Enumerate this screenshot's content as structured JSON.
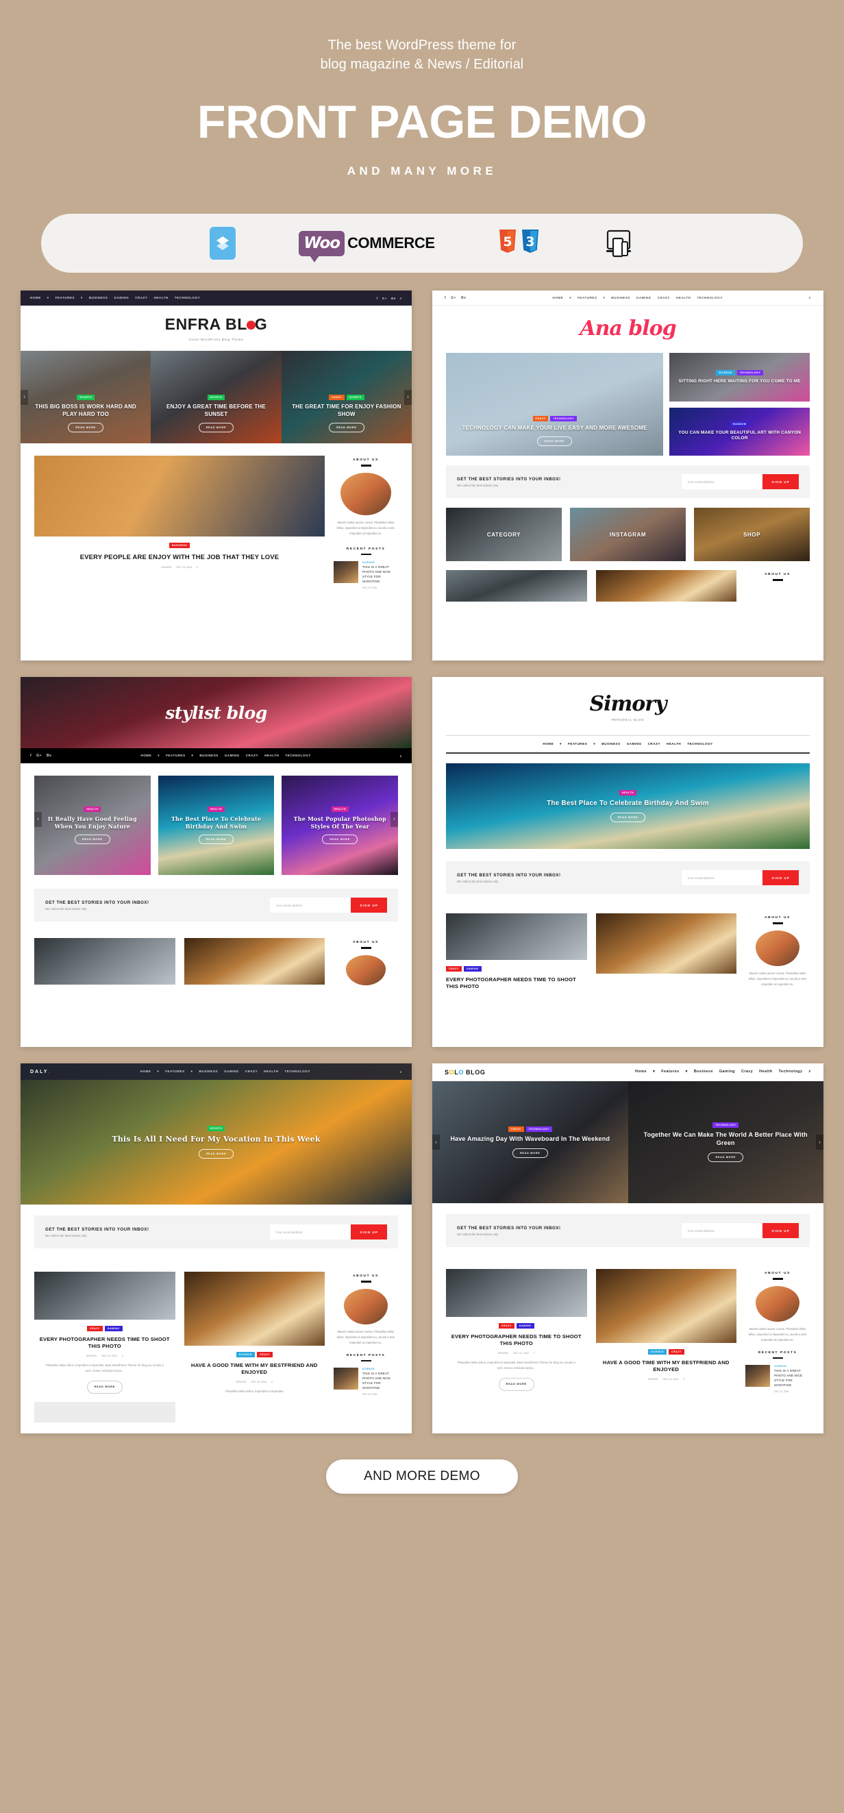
{
  "hero": {
    "subtitle_line1": "The best WordPress theme for",
    "subtitle_line2": "blog magazine &  News / Editorial",
    "title": "FRONT PAGE DEMO",
    "tagline": "AND MANY MORE",
    "background_color": "#c2ab91"
  },
  "badges": {
    "items": [
      {
        "name": "layer-blocks-icon",
        "label": ""
      },
      {
        "name": "woocommerce-logo",
        "label_mark": "Woo",
        "label_text": "COMMERCE"
      },
      {
        "name": "html5-badge",
        "label": "5"
      },
      {
        "name": "css3-badge",
        "label": "3"
      },
      {
        "name": "responsive-devices-icon",
        "label": ""
      }
    ]
  },
  "nav": {
    "items": [
      "HOME",
      "FEATURES",
      "BUSINESS",
      "GAMING",
      "CRAZY",
      "HEALTH",
      "TECHNOLOGY"
    ],
    "items_title_case": [
      "Home",
      "Features",
      "Business",
      "Gaming",
      "Crazy",
      "Health",
      "Technology"
    ],
    "social": [
      "f",
      "G+",
      "Be"
    ],
    "search": "search-icon"
  },
  "newsletter": {
    "title": "GET THE BEST STORIES INTO YOUR INBOX!",
    "subtitle": "We collect the best stories only",
    "input_placeholder": "Your email address",
    "button": "SIGN UP",
    "button_color": "#ef2323"
  },
  "sidebar": {
    "about_heading": "ABOUT US",
    "about_text": "Mauris mattis auctor cursus. Phasellus tellus tellus, imperdiet ut imperdiet eu, iaculis a sem imperdiet ut imperdiet eu.",
    "recent_heading": "RECENT POSTS",
    "recent_post": {
      "category": "SCIENCE",
      "title": "THIS IS A GREAT PHOTO AND NICE STYLE FOR SHOOTING",
      "date": "DEC 24, 2016"
    }
  },
  "demos": [
    {
      "id": "enfra-blog",
      "brand": "ENFRA BLOG",
      "brand_tagline": "Clean WordPress Blog Theme",
      "slides": [
        {
          "cats": [
            {
              "label": "SPORTS",
              "color": "green"
            }
          ],
          "title": "THIS BIG BOSS IS WORK HARD AND PLAY HARD TOO",
          "button": "READ MORE"
        },
        {
          "cats": [
            {
              "label": "SPORTS",
              "color": "green"
            }
          ],
          "title": "ENJOY A GREAT TIME BEFORE THE SUNSET",
          "button": "READ MORE"
        },
        {
          "cats": [
            {
              "label": "CRAZY",
              "color": "orange"
            },
            {
              "label": "SPORTS",
              "color": "green"
            }
          ],
          "title": "THE GREAT TIME FOR ENJOY FASHION SHOW",
          "button": "READ MORE"
        }
      ],
      "post": {
        "cats": [
          {
            "label": "BUSINESS",
            "color": "red"
          }
        ],
        "title": "EVERY PEOPLE ARE ENJOY WITH THE JOB THAT THEY LOVE",
        "meta": [
          "SENORA",
          "DEC 24, 2016",
          "0"
        ]
      }
    },
    {
      "id": "ana-blog",
      "brand": "Ana blog",
      "slides": [
        {
          "cats": [
            {
              "label": "CRAZY",
              "color": "orange"
            },
            {
              "label": "TECHNOLOGY",
              "color": "purple"
            }
          ],
          "title": "TECHNOLOGY CAN MAKE YOUR LIVE EASY AND MORE AWESOME",
          "button": "READ MORE"
        },
        {
          "cats": [
            {
              "label": "SCIENCE",
              "color": "blue"
            },
            {
              "label": "TECHNOLOGY",
              "color": "purple"
            }
          ],
          "title": "SITTING RIGHT HERE WAITING FOR YOU COME TO ME",
          "button": ""
        },
        {
          "cats": [
            {
              "label": "RANDOM",
              "color": "indigo"
            }
          ],
          "title": "YOU CAN MAKE YOUR BEAUTIFUL ART WITH CANYON COLOR",
          "button": ""
        }
      ],
      "tiles": [
        "CATEGORY",
        "INSTAGRAM",
        "SHOP"
      ]
    },
    {
      "id": "stylist-blog",
      "brand": "stylist blog",
      "slides": [
        {
          "cats": [
            {
              "label": "HEALTH",
              "color": "pink"
            }
          ],
          "title": "It Really Have Good Feeling When You Enjoy Nature",
          "button": "READ MORE"
        },
        {
          "cats": [
            {
              "label": "HEALTH",
              "color": "pink"
            }
          ],
          "title": "The Best Place To Celebrate Birthday And Swim",
          "button": "READ MORE"
        },
        {
          "cats": [
            {
              "label": "HEALTH",
              "color": "pink"
            }
          ],
          "title": "The Most Popular Photoshop Styles Of The Year",
          "button": "READ MORE"
        }
      ]
    },
    {
      "id": "simory",
      "brand": "Simory",
      "brand_tagline": "PERSONAL BLOG",
      "slides": [
        {
          "cats": [
            {
              "label": "HEALTH",
              "color": "pink"
            }
          ],
          "title": "The Best Place To Celebrate Birthday And Swim",
          "button": "READ MORE"
        }
      ],
      "post": {
        "cats": [
          {
            "label": "CRAZY",
            "color": "red"
          },
          {
            "label": "GAMING",
            "color": "indigo"
          }
        ],
        "title": "EVERY PHOTOGRAPHER NEEDS TIME TO SHOOT THIS PHOTO",
        "meta": [
          "SENORA",
          "DEC 24, 2016",
          "0"
        ]
      }
    },
    {
      "id": "daly",
      "brand": "DALY",
      "slides": [
        {
          "cats": [
            {
              "label": "SPORTS",
              "color": "green"
            }
          ],
          "title": "This Is All I Need For My Vocation In This Week",
          "button": "READ MORE"
        }
      ],
      "post": {
        "cats": [
          {
            "label": "CRAZY",
            "color": "red"
          },
          {
            "label": "GAMING",
            "color": "indigo"
          }
        ],
        "title": "EVERY PHOTOGRAPHER NEEDS TIME TO SHOOT THIS PHOTO",
        "meta": [
          "SENORA",
          "DEC 24, 2016",
          "0"
        ],
        "excerpt": "Phasellus tellus tellus, imperdiet ut imperdiet. Best WordPress Theme for blog eu, iaculis a sem. Donec vehicula luctus...",
        "button": "READ MORE"
      },
      "post2": {
        "cats": [
          {
            "label": "SCIENCE",
            "color": "blue"
          },
          {
            "label": "CRAZY",
            "color": "red"
          }
        ],
        "title": "HAVE A GOOD TIME WITH MY BESTFRIEND AND ENJOYED",
        "meta": [
          "SENORA",
          "DEC 24, 2016",
          "0"
        ],
        "excerpt": "Phasellus tellus tellus, imperdiet ut imperdiet"
      }
    },
    {
      "id": "solo-blog",
      "brand": "SOLO BLOG",
      "slides": [
        {
          "cats": [
            {
              "label": "CRAZY",
              "color": "orange"
            },
            {
              "label": "TECHNOLOGY",
              "color": "purple"
            }
          ],
          "title": "Have Amazing Day With Waveboard In The Weekend",
          "button": "READ MORE"
        },
        {
          "cats": [
            {
              "label": "TECHNOLOGY",
              "color": "purple"
            }
          ],
          "title": "Together We Can Make The World A Better Place With Green",
          "button": "READ MORE"
        }
      ],
      "post": {
        "cats": [
          {
            "label": "CRAZY",
            "color": "red"
          },
          {
            "label": "GAMING",
            "color": "indigo"
          }
        ],
        "title": "EVERY PHOTOGRAPHER NEEDS TIME TO SHOOT THIS PHOTO",
        "meta": [
          "SENORA",
          "DEC 24, 2016",
          "0"
        ],
        "excerpt": "Phasellus tellus tellus, imperdiet ut imperdiet. Best WordPress Theme for blog eu, iaculis a sem. Donec vehicula luctus...",
        "button": "READ MORE"
      },
      "post2": {
        "cats": [
          {
            "label": "SCIENCE",
            "color": "blue"
          },
          {
            "label": "CRAZY",
            "color": "red"
          }
        ],
        "title": "HAVE A GOOD TIME WITH MY BESTFRIEND AND ENJOYED",
        "meta": [
          "SENORA",
          "DEC 24, 2016",
          "0"
        ]
      }
    }
  ],
  "footer": {
    "more_button": "AND MORE DEMO"
  }
}
